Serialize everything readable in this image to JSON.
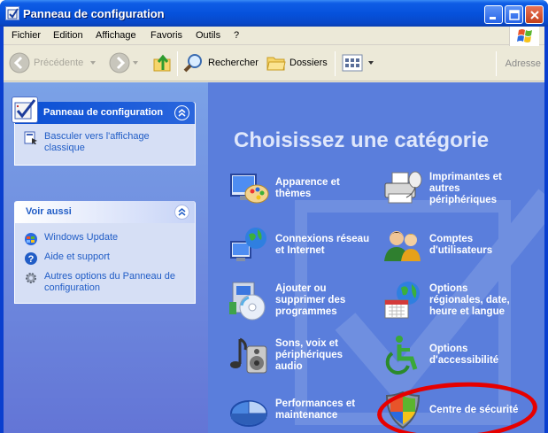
{
  "window": {
    "title": "Panneau de configuration"
  },
  "menu": [
    "Fichier",
    "Edition",
    "Affichage",
    "Favoris",
    "Outils",
    "?"
  ],
  "toolbar": {
    "back_label": "Précédente",
    "search_label": "Rechercher",
    "folders_label": "Dossiers",
    "address_label": "Adresse"
  },
  "left_panel": {
    "title": "Panneau de configuration",
    "switch_view": "Basculer vers l'affichage classique",
    "see_also_title": "Voir aussi",
    "see_also": [
      "Windows Update",
      "Aide et support",
      "Autres options du Panneau de configuration"
    ]
  },
  "main": {
    "heading": "Choisissez une catégorie",
    "categories": [
      {
        "label": "Apparence et thèmes",
        "icon": "appearance-icon"
      },
      {
        "label": "Imprimantes et autres périphériques",
        "icon": "printer-icon"
      },
      {
        "label": "Connexions réseau et Internet",
        "icon": "network-icon"
      },
      {
        "label": "Comptes d'utilisateurs",
        "icon": "users-icon"
      },
      {
        "label": "Ajouter ou supprimer des programmes",
        "icon": "programs-icon"
      },
      {
        "label": "Options régionales, date, heure et langue",
        "icon": "regional-icon"
      },
      {
        "label": "Sons, voix et périphériques audio",
        "icon": "sound-icon"
      },
      {
        "label": "Options d'accessibilité",
        "icon": "accessibility-icon"
      },
      {
        "label": "Performances et maintenance",
        "icon": "performance-icon"
      },
      {
        "label": "Centre de sécurité",
        "icon": "security-shield-icon"
      }
    ]
  },
  "colors": {
    "titlebar": "#0652dc",
    "pane": "#5a7edc",
    "highlight": "#e60000"
  }
}
